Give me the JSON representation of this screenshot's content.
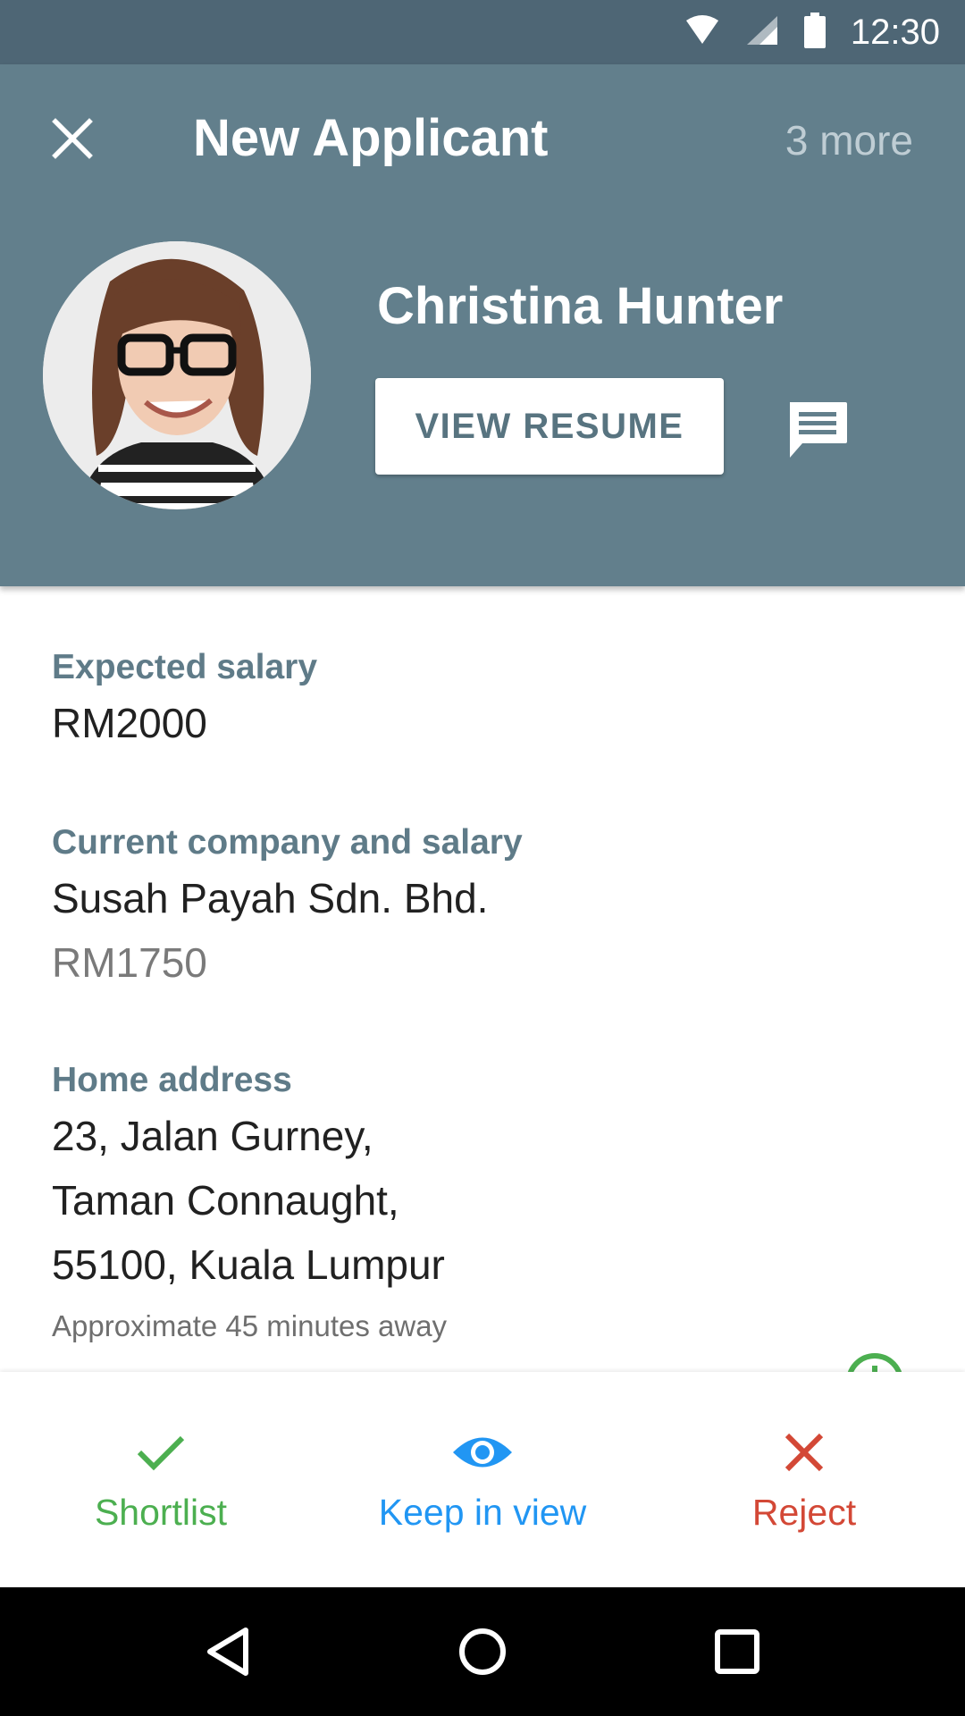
{
  "status_bar": {
    "time": "12:30",
    "icons": [
      "wifi-icon",
      "signal-icon",
      "battery-icon"
    ]
  },
  "header": {
    "close_icon": "close-icon",
    "title": "New Applicant",
    "more_label": "3 more",
    "applicant_name": "Christina Hunter",
    "resume_button_label": "VIEW RESUME",
    "message_icon": "message-icon",
    "background_color": "#627f8c"
  },
  "details": {
    "expected_salary": {
      "label": "Expected salary",
      "value": "RM2000"
    },
    "current_company": {
      "label": "Current company and salary",
      "company": "Susah Payah Sdn. Bhd.",
      "salary": "RM1750"
    },
    "home_address": {
      "label": "Home address",
      "lines": [
        "23, Jalan Gurney,",
        "Taman Connaught,",
        "55100, Kuala Lumpur"
      ],
      "note": "Approximate 45 minutes away"
    }
  },
  "actions": [
    {
      "label": "Shortlist",
      "icon": "check-icon",
      "color": "#4caf50"
    },
    {
      "label": "Keep in view",
      "icon": "eye-icon",
      "color": "#2196f3"
    },
    {
      "label": "Reject",
      "icon": "close-icon",
      "color": "#d34836"
    }
  ],
  "nav_bar": {
    "icons": [
      "back-icon",
      "home-icon",
      "recents-icon"
    ]
  }
}
